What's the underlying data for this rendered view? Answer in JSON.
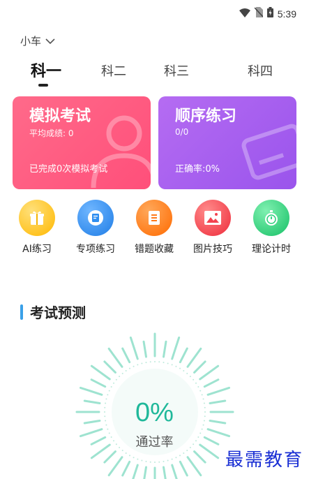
{
  "status_bar": {
    "time": "5:39"
  },
  "vehicle": {
    "label": "小车"
  },
  "tabs": [
    "科一",
    "科二",
    "科三",
    "科四"
  ],
  "cards": {
    "mock": {
      "title": "模拟考试",
      "subtitle": "平均成绩: 0",
      "footer": "已完成0次模拟考试"
    },
    "order": {
      "title": "顺序练习",
      "subtitle": "0/0",
      "footer": "正确率:0%"
    }
  },
  "quick_actions": [
    {
      "label": "AI练习",
      "icon": "gift-icon",
      "color": "#ffc22e"
    },
    {
      "label": "专项练习",
      "icon": "note-icon",
      "color": "#2f8ef0"
    },
    {
      "label": "错题收藏",
      "icon": "list-icon",
      "color": "#ff7a1a"
    },
    {
      "label": "图片技巧",
      "icon": "image-icon",
      "color": "#f3424f"
    },
    {
      "label": "理论计时",
      "icon": "stopwatch-icon",
      "color": "#2bd07a"
    }
  ],
  "forecast": {
    "title": "考试预测",
    "pass_rate": "0%",
    "pass_rate_label": "通过率"
  },
  "watermark": "最需教育"
}
